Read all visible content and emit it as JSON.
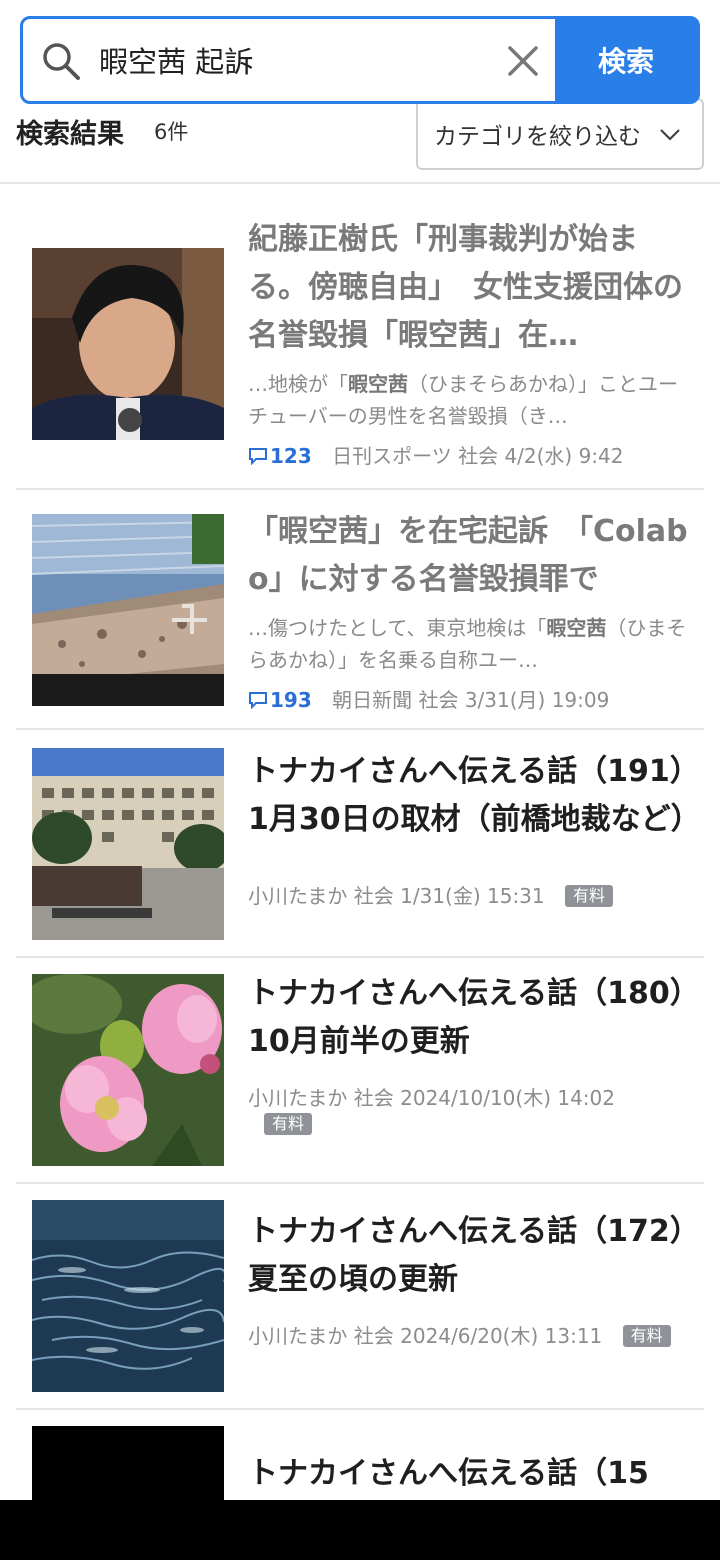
{
  "search": {
    "query": "暇空茜 起訴",
    "button_label": "検索"
  },
  "results_header": {
    "title": "検索結果",
    "count": "6件",
    "category_label": "カテゴリを絞り込む"
  },
  "results": [
    {
      "title": "紀藤正樹氏「刑事裁判が始まる。傍聴自由」　女性支援団体の名誉毀損「暇空茜」在…",
      "snippet_pre": "…地検が「",
      "snippet_hl": "暇空茜",
      "snippet_post": "（ひまそらあかね）」ことユーチューバーの男性を名誉毀損（き…",
      "comments": "123",
      "source": "日刊スポーツ",
      "category": "社会",
      "date": "4/2(水) 9:42",
      "paid_label": ""
    },
    {
      "title": "「暇空茜」を在宅起訴　「Colabo」に対する名誉毀損罪で",
      "snippet_pre": "…傷つけたとして、東京地検は「",
      "snippet_hl": "暇空茜",
      "snippet_post": "（ひまそらあかね）」を名乗る自称ユー…",
      "comments": "193",
      "source": "朝日新聞",
      "category": "社会",
      "date": "3/31(月) 19:09",
      "paid_label": ""
    },
    {
      "title": "トナカイさんへ伝える話（191）1月30日の取材（前橋地裁など）",
      "source": "小川たまか",
      "category": "社会",
      "date": "1/31(金) 15:31",
      "paid_label": "有料"
    },
    {
      "title": "トナカイさんへ伝える話（180）10月前半の更新",
      "source": "小川たまか",
      "category": "社会",
      "date": "2024/10/10(木) 14:02",
      "paid_label": "有料"
    },
    {
      "title": "トナカイさんへ伝える話（172）夏至の頃の更新",
      "source": "小川たまか",
      "category": "社会",
      "date": "2024/6/20(木) 13:11",
      "paid_label": "有料"
    },
    {
      "title": "トナカイさんへ伝える話（15",
      "source": "",
      "category": "",
      "date": "",
      "paid_label": ""
    }
  ],
  "icons": {
    "search": "search-icon",
    "clear": "close-icon",
    "chevron": "chevron-down-icon",
    "comment": "comment-icon"
  },
  "colors": {
    "accent": "#2a7ee8",
    "comment": "#2a6ed6",
    "paid_badge": "#8f9398"
  }
}
